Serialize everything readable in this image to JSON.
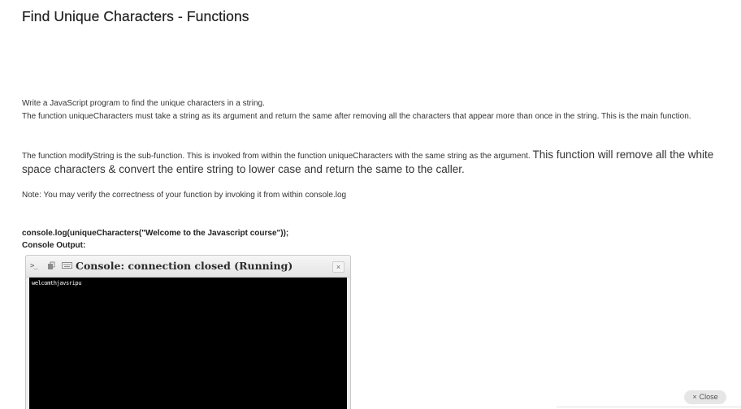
{
  "page": {
    "title": "Find Unique Characters - Functions"
  },
  "description": {
    "line1": "Write a JavaScript program to find the unique characters in a string.",
    "line2": "The function uniqueCharacters must take a string as its argument and return the same after removing all the characters that appear more than once in the string. This is the main function.",
    "para2_small": "The function modifyString is the sub-function. This is invoked from within the function uniqueCharacters with the same string as the argument.",
    "para2_large": "This function will remove all the white space characters & convert the entire string to lower case and return the same to the caller.",
    "note": "Note: You may verify the correctness of your function by invoking it from within console.log"
  },
  "example": {
    "code": "console.log(uniqueCharacters(\"Welcome to the Javascript course\"));",
    "output_label": "Console Output:"
  },
  "console": {
    "prompt_icon": ">_",
    "copy_icon": "▯",
    "keyboard_icon": "⌨",
    "title": "Console: connection closed (Running)",
    "close_label": "×",
    "output": "welcomthjavsripu"
  },
  "footer": {
    "close_icon": "×",
    "close_label": "Close"
  }
}
